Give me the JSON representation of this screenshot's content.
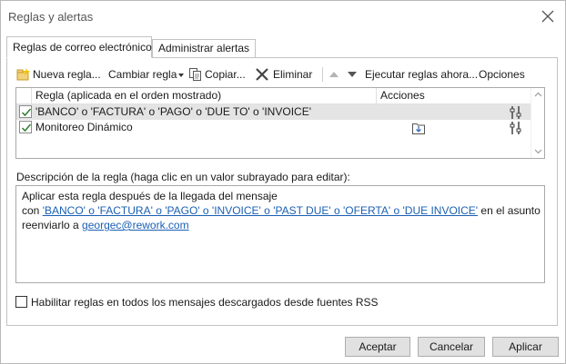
{
  "window": {
    "title": "Reglas y alertas"
  },
  "tabs": [
    {
      "label": "Reglas de correo electrónico",
      "active": true
    },
    {
      "label": "Administrar alertas",
      "active": false
    }
  ],
  "toolbar": {
    "new_rule": "Nueva regla...",
    "change_rule": "Cambiar regla",
    "copy": "Copiar...",
    "delete": "Eliminar",
    "run_rules": "Ejecutar reglas ahora...",
    "options": "Opciones"
  },
  "rules_table": {
    "headers": {
      "rule": "Regla (aplicada en el orden mostrado)",
      "actions": "Acciones"
    },
    "rows": [
      {
        "name": "'BANCO' o 'FACTURA' o 'PAGO' o 'DUE TO' o 'INVOICE'",
        "checked": true,
        "selected": true,
        "action_icons": [
          "rule-settings-icon"
        ]
      },
      {
        "name": "Monitoreo Dinámico",
        "checked": true,
        "selected": false,
        "action_icons": [
          "move-to-folder-icon",
          "rule-settings-icon"
        ]
      }
    ]
  },
  "description": {
    "label": "Descripción de la regla (haga clic en un valor subrayado para editar):",
    "line1": "Aplicar esta regla después de la llegada del mensaje",
    "line2_prefix": "con ",
    "line2_link": "'BANCO' o 'FACTURA' o 'PAGO' o 'INVOICE' o 'PAST DUE' o 'OFERTA' o 'DUE INVOICE'",
    "line2_suffix": " en el asunto",
    "line3_prefix": "reenviarlo a ",
    "line3_link": "georgec@rework.com"
  },
  "rss": {
    "label": "Habilitar reglas en todos los mensajes descargados desde fuentes RSS",
    "checked": false
  },
  "buttons": {
    "ok": "Aceptar",
    "cancel": "Cancelar",
    "apply": "Aplicar"
  },
  "colors": {
    "link": "#1a5fb4",
    "selected_row": "#e4e4e4",
    "check_mark": "#2e7d32"
  }
}
